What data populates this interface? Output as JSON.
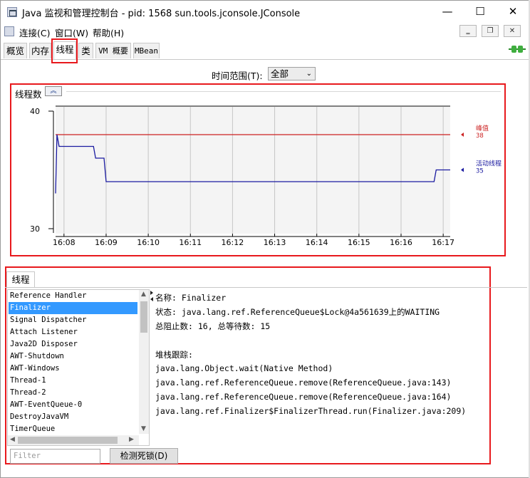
{
  "window": {
    "title": "Java 监视和管理控制台 - pid: 1568 sun.tools.jconsole.JConsole",
    "minimize": "—",
    "maximize": "☐",
    "close": "✕"
  },
  "menu": {
    "items": [
      "连接(C)",
      "窗口(W)",
      "帮助(H)"
    ],
    "mdi_minimize": "‗",
    "mdi_restore": "❐",
    "mdi_close": "✕"
  },
  "tabs": [
    "概览",
    "内存",
    "线程",
    "类",
    "VM 概要",
    "MBean"
  ],
  "active_tab": "线程",
  "time_range": {
    "label": "时间范围(T):",
    "value": "全部"
  },
  "thread_count_panel": {
    "title": "线程数",
    "collapse_icon": "chevrons-up-icon"
  },
  "chart_data": {
    "type": "line",
    "title": "线程数",
    "ylim": [
      30,
      40
    ],
    "y_ticks": [
      "30",
      "40"
    ],
    "x_ticks": [
      "16:08",
      "16:09",
      "16:10",
      "16:11",
      "16:12",
      "16:13",
      "16:14",
      "16:15",
      "16:16",
      "16:17"
    ],
    "series": [
      {
        "name": "峰值",
        "color": "#cc2222",
        "last_value": "38",
        "points": [
          [
            "16:07:48",
            38
          ],
          [
            "16:17:10",
            38
          ]
        ]
      },
      {
        "name": "活动线程",
        "color": "#1a1aa0",
        "last_value": "35",
        "points": [
          [
            "16:07:48",
            33
          ],
          [
            "16:07:50",
            38
          ],
          [
            "16:07:53",
            37
          ],
          [
            "16:08:42",
            37
          ],
          [
            "16:08:45",
            36
          ],
          [
            "16:08:57",
            36
          ],
          [
            "16:09:00",
            34
          ],
          [
            "16:16:47",
            34
          ],
          [
            "16:16:50",
            35
          ],
          [
            "16:17:10",
            35
          ]
        ]
      }
    ]
  },
  "bottom_tab": "线程",
  "threads": {
    "items": [
      "Reference Handler",
      "Finalizer",
      "Signal Dispatcher",
      "Attach Listener",
      "Java2D Disposer",
      "AWT-Shutdown",
      "AWT-Windows",
      "Thread-1",
      "Thread-2",
      "AWT-EventQueue-0",
      "DestroyJavaVM",
      "TimerQueue"
    ],
    "selected": "Finalizer",
    "filter_placeholder": "Filter",
    "deadlock_button": "检测死锁(D)"
  },
  "details": {
    "lines": [
      "名称: Finalizer",
      "状态: java.lang.ref.ReferenceQueue$Lock@4a561639上的WAITING",
      "总阻止数: 16, 总等待数: 15",
      "",
      "堆栈跟踪:",
      "java.lang.Object.wait(Native Method)",
      "java.lang.ref.ReferenceQueue.remove(ReferenceQueue.java:143)",
      "java.lang.ref.ReferenceQueue.remove(ReferenceQueue.java:164)",
      "java.lang.ref.Finalizer$FinalizerThread.run(Finalizer.java:209)"
    ]
  },
  "colors": {
    "highlight": "#e8191d",
    "selection": "#3399ff",
    "peak_line": "#cc2222",
    "live_line": "#1a1aa0"
  }
}
